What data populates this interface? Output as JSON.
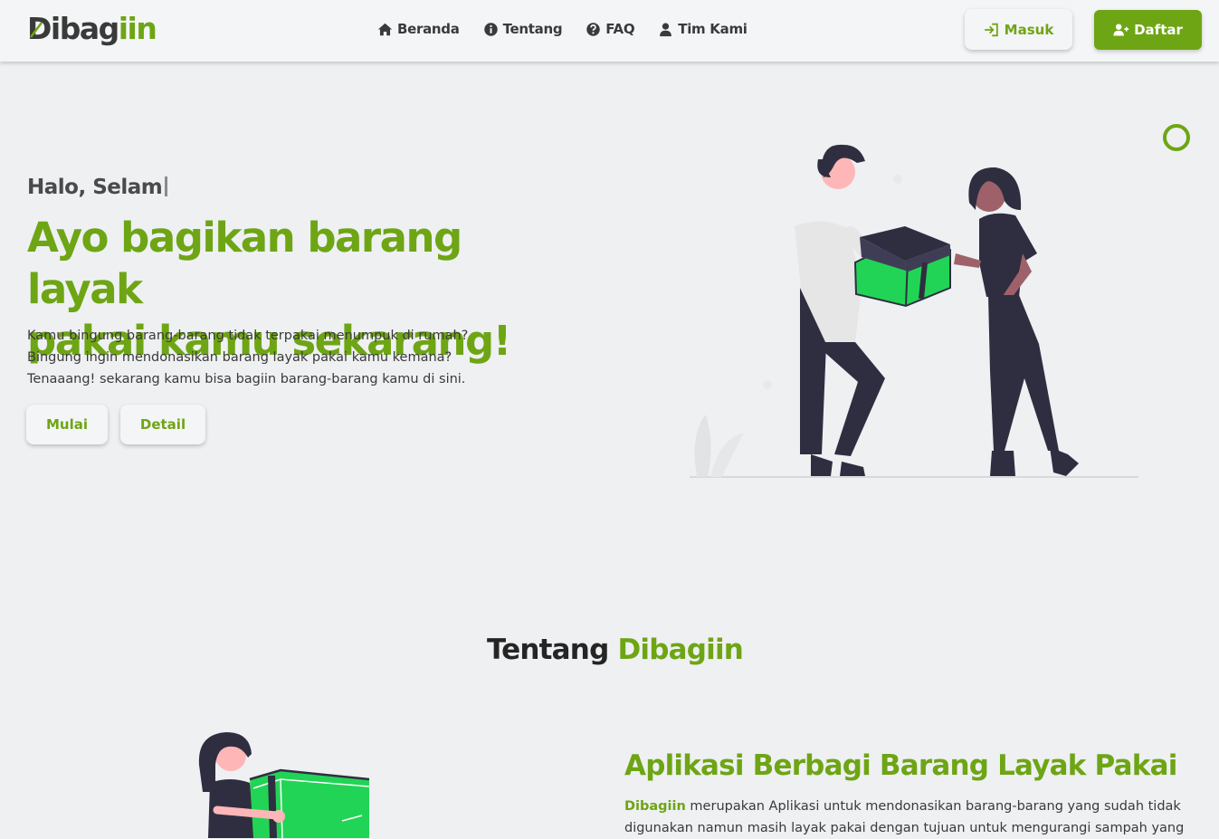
{
  "navbar": {
    "logo": {
      "dark": "Dibag",
      "green": "iin"
    },
    "menu": [
      {
        "label": "Beranda",
        "icon": "home-icon"
      },
      {
        "label": "Tentang",
        "icon": "info-icon"
      },
      {
        "label": "FAQ",
        "icon": "question-icon"
      },
      {
        "label": "Tim Kami",
        "icon": "user-icon"
      }
    ],
    "login_label": "Masuk",
    "register_label": "Daftar"
  },
  "hero": {
    "greeting": "Halo, Selam",
    "title_line1": "Ayo bagikan barang layak",
    "title_line2": "pakai kamu sekarang!",
    "desc_line1": "Kamu bingung barang-barang tidak terpakai menumpuk di rumah?",
    "desc_line2": "Bingung ingin mendonasikan barang layak pakai kamu kemana?",
    "desc_line3": "Tenaaang! sekarang kamu bisa bagiin barang-barang kamu di sini.",
    "start_label": "Mulai",
    "detail_label": "Detail"
  },
  "about": {
    "heading_dark": "Tentang",
    "heading_green": "Dibagiin",
    "title": "Aplikasi Berbagi Barang Layak Pakai",
    "brand": "Dibagiin",
    "text_line1_rest": " merupakan Aplikasi untuk mendonasikan barang-barang yang sudah tidak",
    "text_line2": "digunakan namun masih layak pakai dengan tujuan untuk mengurangi sampah yang"
  },
  "colors": {
    "accent": "#6ea514",
    "box_green": "#22d455",
    "dark_figure": "#2f2e41"
  }
}
